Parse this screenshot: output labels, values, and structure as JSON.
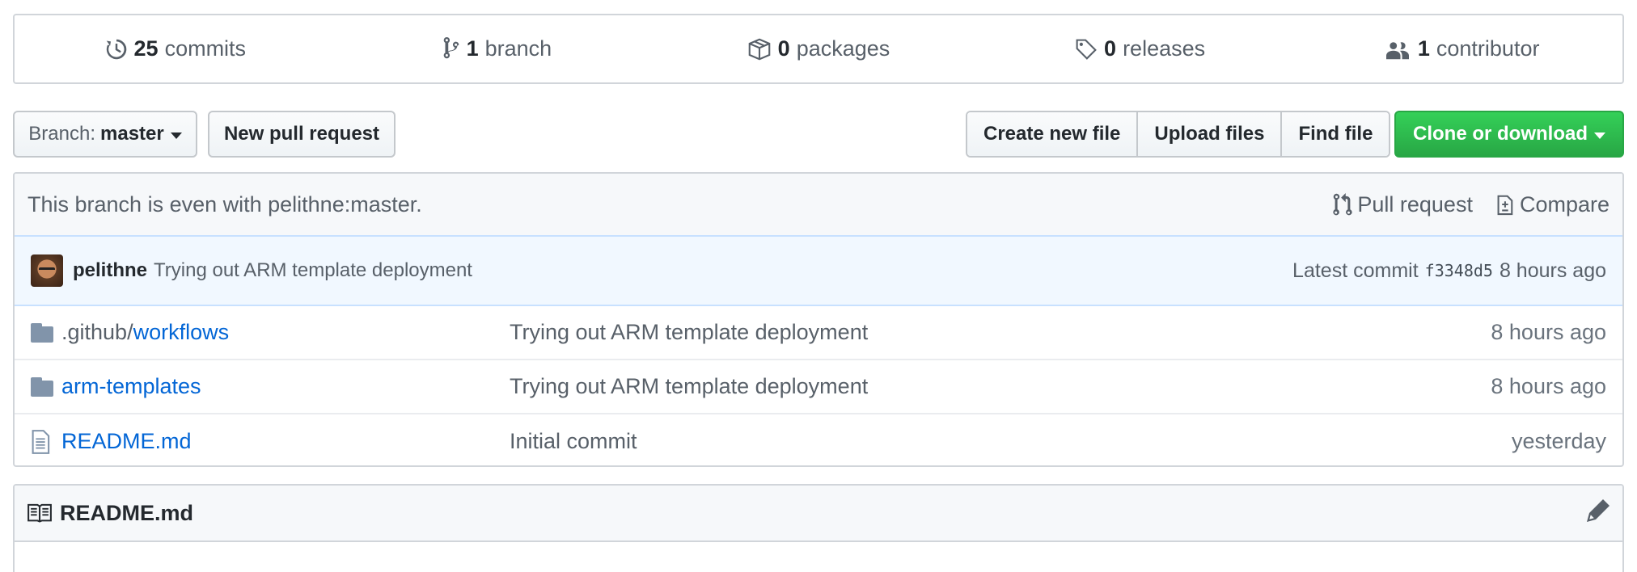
{
  "summary": {
    "commits": {
      "count": "25",
      "label": "commits",
      "icon": "history-icon"
    },
    "branches": {
      "count": "1",
      "label": "branch",
      "icon": "git-branch-icon"
    },
    "packages": {
      "count": "0",
      "label": "packages",
      "icon": "package-icon"
    },
    "releases": {
      "count": "0",
      "label": "releases",
      "icon": "tag-icon"
    },
    "contributors": {
      "count": "1",
      "label": "contributor",
      "icon": "people-icon"
    }
  },
  "toolbar": {
    "branch_prefix": "Branch:",
    "branch_name": "master",
    "new_pull_request": "New pull request",
    "create_new_file": "Create new file",
    "upload_files": "Upload files",
    "find_file": "Find file",
    "clone_or_download": "Clone or download"
  },
  "branch_info": {
    "text": "This branch is even with pelithne:master.",
    "pull_request": "Pull request",
    "compare": "Compare"
  },
  "latest_commit": {
    "author": "pelithne",
    "message": "Trying out ARM template deployment",
    "label": "Latest commit",
    "sha": "f3348d5",
    "age": "8 hours ago"
  },
  "files": [
    {
      "type": "folder",
      "prefix": ".github/",
      "name": "workflows",
      "message": "Trying out ARM template deployment",
      "age": "8 hours ago"
    },
    {
      "type": "folder",
      "prefix": "",
      "name": "arm-templates",
      "message": "Trying out ARM template deployment",
      "age": "8 hours ago"
    },
    {
      "type": "file",
      "prefix": "",
      "name": "README.md",
      "message": "Initial commit",
      "age": "yesterday"
    }
  ],
  "readme": {
    "title": "README.md"
  },
  "colors": {
    "accent": "#0366d6",
    "green": "#28a745",
    "commit_bg": "#f1f8ff"
  }
}
